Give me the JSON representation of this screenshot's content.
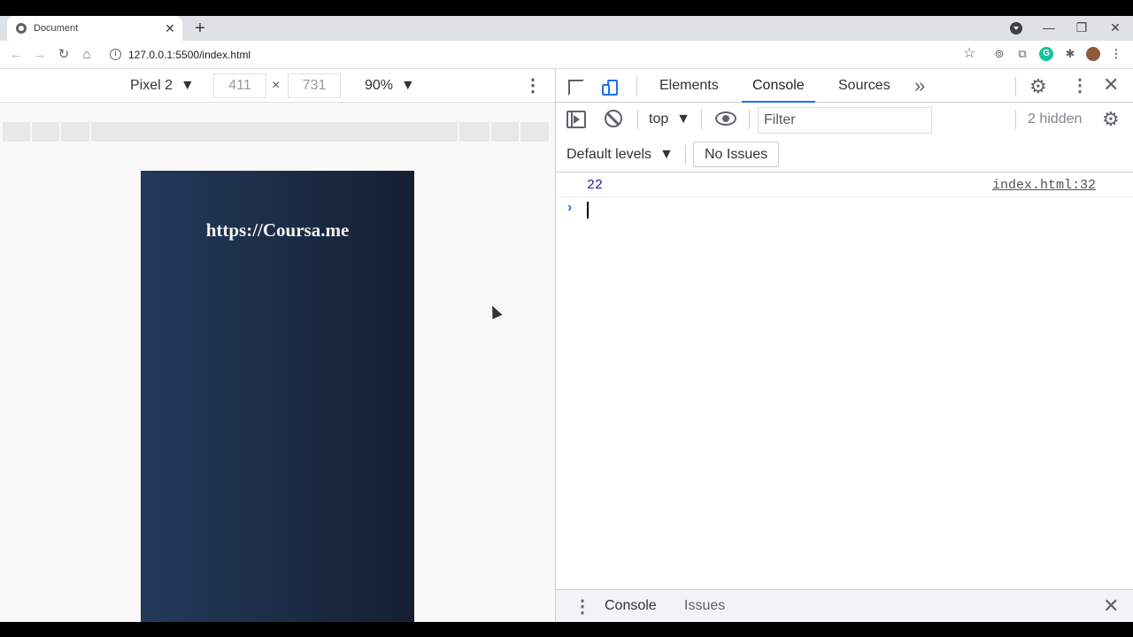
{
  "browser": {
    "tab": {
      "title": "Document",
      "close": "✕"
    },
    "new_tab": "+",
    "window": {
      "minimize": "—",
      "restore": "❐",
      "close": "✕"
    },
    "nav": {
      "back": "←",
      "forward": "→",
      "reload": "↻",
      "home": "⌂"
    },
    "address": "127.0.0.1:5500/index.html",
    "bookmark": "☆",
    "menu": "⋮"
  },
  "device_toolbar": {
    "device": "Pixel 2",
    "width": "411",
    "times": "×",
    "height": "731",
    "zoom": "90%",
    "more": "⋮"
  },
  "page": {
    "title": "https://Coursa.me",
    "background_colors": [
      "#233a5a",
      "#161f32"
    ]
  },
  "devtools": {
    "tabs": [
      "Elements",
      "Console",
      "Sources"
    ],
    "active_tab": "Console",
    "more_tabs": "»",
    "context": "top",
    "filter_placeholder": "Filter",
    "hidden": "2 hidden",
    "levels": "Default levels",
    "issues": "No Issues",
    "messages": [
      {
        "value": "22",
        "source": "index.html:32"
      }
    ],
    "prompt": "›",
    "drawer": {
      "tabs": [
        "Console",
        "Issues"
      ]
    },
    "accent_color": "#1a73e8"
  }
}
